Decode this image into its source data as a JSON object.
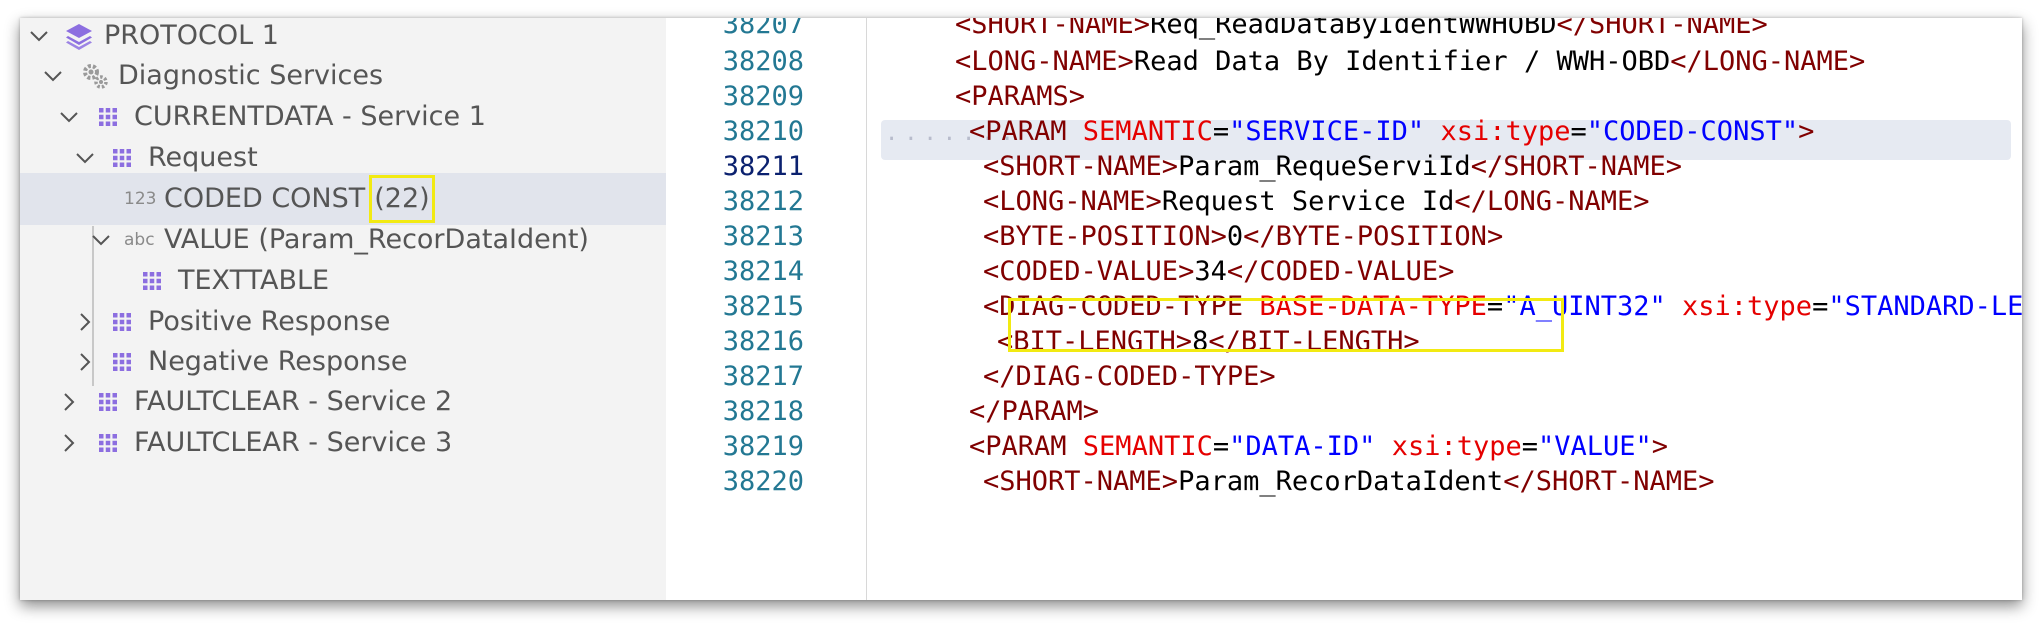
{
  "tree": {
    "items": [
      {
        "label": "PROTOCOL 1",
        "expanded": true,
        "icon": "layers-icon"
      },
      {
        "label": "Diagnostic Services",
        "expanded": true,
        "icon": "gears-icon"
      },
      {
        "label": "CURRENTDATA - Service 1",
        "expanded": true,
        "icon": "grid-icon"
      },
      {
        "label": "Request",
        "expanded": true,
        "icon": "grid-icon"
      },
      {
        "badge": "123",
        "label": "CODED CONST",
        "value": "(22)",
        "selected": true,
        "icon": "number-icon"
      },
      {
        "badge": "abc",
        "label": "VALUE (Param_RecorDataIdent)",
        "expanded": true,
        "icon": "text-icon"
      },
      {
        "label": "TEXTTABLE",
        "icon": "grid-icon"
      },
      {
        "label": "Positive Response",
        "expanded": false,
        "icon": "grid-icon"
      },
      {
        "label": "Negative Response",
        "expanded": false,
        "icon": "grid-icon"
      },
      {
        "label": "FAULTCLEAR - Service 2",
        "expanded": false,
        "icon": "grid-icon"
      },
      {
        "label": "FAULTCLEAR - Service 3",
        "expanded": false,
        "icon": "grid-icon"
      }
    ]
  },
  "editor": {
    "active_line": "38211",
    "line_numbers": [
      "38207",
      "38208",
      "38209",
      "38210",
      "38211",
      "38212",
      "38213",
      "38214",
      "38215",
      "38216",
      "38217",
      "38218",
      "38219",
      "38220"
    ],
    "lines": [
      [
        {
          "k": "t",
          "s": "<SHORT-NAME>"
        },
        {
          "k": "p",
          "s": "Req_ReadDataByIdentWWHOBD"
        },
        {
          "k": "t",
          "s": "</SHORT-NAME>"
        }
      ],
      [
        {
          "k": "t",
          "s": "<LONG-NAME>"
        },
        {
          "k": "p",
          "s": "Read Data By Identifier / WWH-OBD"
        },
        {
          "k": "t",
          "s": "</LONG-NAME>"
        }
      ],
      [
        {
          "k": "t",
          "s": "<PARAMS>"
        }
      ],
      [
        {
          "k": "t",
          "s": "<PARAM "
        },
        {
          "k": "a",
          "s": "SEMANTIC"
        },
        {
          "k": "p",
          "s": "="
        },
        {
          "k": "v",
          "s": "\"SERVICE-ID\""
        },
        {
          "k": "p",
          "s": " "
        },
        {
          "k": "a",
          "s": "xsi:type"
        },
        {
          "k": "p",
          "s": "="
        },
        {
          "k": "v",
          "s": "\"CODED-CONST\""
        },
        {
          "k": "t",
          "s": ">"
        }
      ],
      [
        {
          "k": "t",
          "s": "<SHORT-NAME>"
        },
        {
          "k": "p",
          "s": "Param_RequeServiId"
        },
        {
          "k": "t",
          "s": "</SHORT-NAME>"
        }
      ],
      [
        {
          "k": "t",
          "s": "<LONG-NAME>"
        },
        {
          "k": "p",
          "s": "Request Service Id"
        },
        {
          "k": "t",
          "s": "</LONG-NAME>"
        }
      ],
      [
        {
          "k": "t",
          "s": "<BYTE-POSITION>"
        },
        {
          "k": "p",
          "s": "0"
        },
        {
          "k": "t",
          "s": "</BYTE-POSITION>"
        }
      ],
      [
        {
          "k": "t",
          "s": "<CODED-VALUE>"
        },
        {
          "k": "p",
          "s": "34"
        },
        {
          "k": "t",
          "s": "</CODED-VALUE>"
        }
      ],
      [
        {
          "k": "t",
          "s": "<DIAG-CODED-TYPE "
        },
        {
          "k": "a",
          "s": "BASE-DATA-TYPE"
        },
        {
          "k": "p",
          "s": "="
        },
        {
          "k": "v",
          "s": "\"A_UINT32\""
        },
        {
          "k": "p",
          "s": " "
        },
        {
          "k": "a",
          "s": "xsi:type"
        },
        {
          "k": "p",
          "s": "="
        },
        {
          "k": "v",
          "s": "\"STANDARD-LENGTH-TYPE\""
        },
        {
          "k": "t",
          "s": ">"
        }
      ],
      [
        {
          "k": "t",
          "s": "<BIT-LENGTH>"
        },
        {
          "k": "p",
          "s": "8"
        },
        {
          "k": "t",
          "s": "</BIT-LENGTH>"
        }
      ],
      [
        {
          "k": "t",
          "s": "</DIAG-CODED-TYPE>"
        }
      ],
      [
        {
          "k": "t",
          "s": "</PARAM>"
        }
      ],
      [
        {
          "k": "t",
          "s": "<PARAM "
        },
        {
          "k": "a",
          "s": "SEMANTIC"
        },
        {
          "k": "p",
          "s": "="
        },
        {
          "k": "v",
          "s": "\"DATA-ID\""
        },
        {
          "k": "p",
          "s": " "
        },
        {
          "k": "a",
          "s": "xsi:type"
        },
        {
          "k": "p",
          "s": "="
        },
        {
          "k": "v",
          "s": "\"VALUE\""
        },
        {
          "k": "t",
          "s": ">"
        }
      ],
      [
        {
          "k": "t",
          "s": "<SHORT-NAME>"
        },
        {
          "k": "p",
          "s": "Param_RecorDataIdent"
        },
        {
          "k": "t",
          "s": "</SHORT-NAME>"
        }
      ]
    ]
  },
  "colors": {
    "tag": "#800000",
    "attribute": "#e50000",
    "string": "#0000ff",
    "line_number": "#237893",
    "highlight_box": "#f2ea12",
    "icon": "#8c6ee0"
  }
}
